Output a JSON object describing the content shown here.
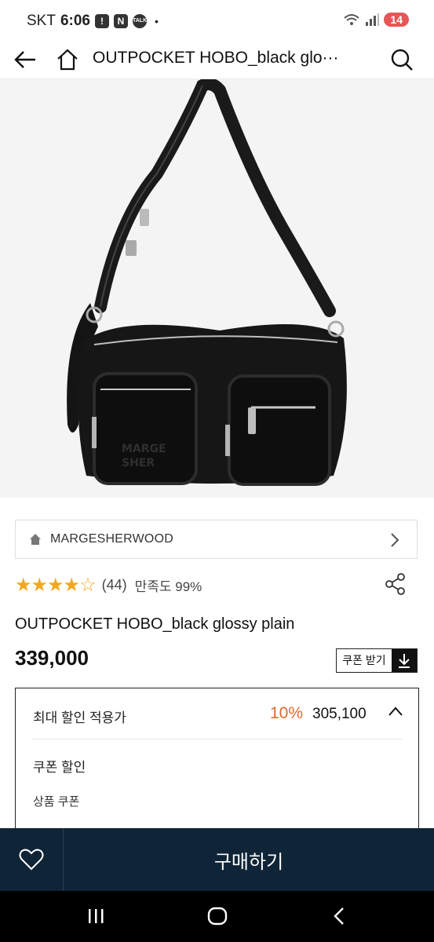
{
  "status": {
    "carrier": "SKT",
    "time": "6:06",
    "notif_icons": [
      "alert-icon",
      "n-icon",
      "talk-icon"
    ],
    "dot": "•",
    "battery": "14"
  },
  "header": {
    "title": "OUTPOCKET HOBO_black glo···",
    "icons": [
      "back-arrow-icon",
      "home-icon",
      "search-icon"
    ]
  },
  "brand": {
    "name": "MARGESHERWOOD"
  },
  "rating": {
    "stars_filled": 4,
    "stars_total": 5,
    "count": "(44)",
    "satisfaction": "만족도 99%"
  },
  "product": {
    "name": "OUTPOCKET HOBO_black glossy plain",
    "price": "339,000",
    "coupon_label": "쿠폰 받기"
  },
  "discount": {
    "title": "최대 할인 적용가",
    "percent": "10%",
    "amount": "305,100",
    "coupon_section": "쿠폰 할인",
    "product_coupon": "상품 쿠폰"
  },
  "bottom": {
    "buy_label": "구매하기"
  },
  "colors": {
    "accent": "#e0692c",
    "star": "#f2a81d",
    "bottom_bar": "#0f2436"
  }
}
